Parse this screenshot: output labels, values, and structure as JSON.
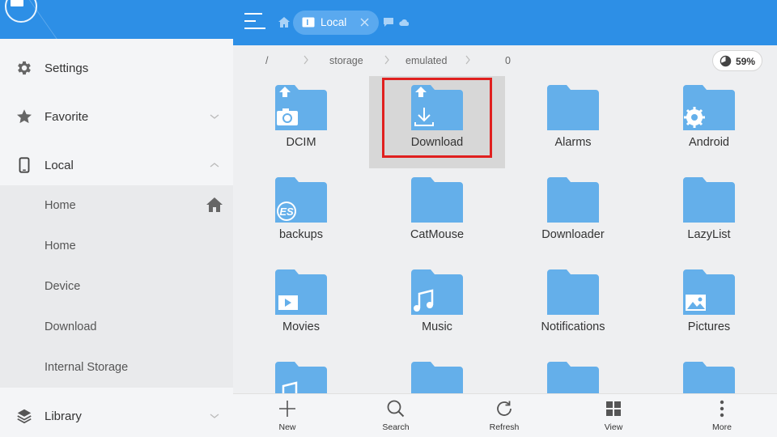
{
  "colors": {
    "accent": "#2d8fe6",
    "folder": "#64afea",
    "highlight": "#e0201f"
  },
  "sidebar": {
    "items": [
      {
        "label": "Settings",
        "icon": "gear-icon"
      },
      {
        "label": "Favorite",
        "icon": "star-icon"
      },
      {
        "label": "Local",
        "icon": "phone-icon"
      },
      {
        "label": "Library",
        "icon": "layers-icon"
      }
    ],
    "local_sub": [
      {
        "label": "Home"
      },
      {
        "label": "Home"
      },
      {
        "label": "Device"
      },
      {
        "label": "Download"
      },
      {
        "label": "Internal Storage"
      }
    ]
  },
  "header": {
    "tab_label": "Local"
  },
  "path": {
    "crumbs": [
      "/",
      "storage",
      "emulated",
      "0"
    ],
    "storage_usage": "59%"
  },
  "folders": [
    {
      "name": "DCIM",
      "badge": "camera-icon",
      "pinned": true
    },
    {
      "name": "Download",
      "badge": "download-arrow-icon",
      "pinned": true,
      "selected": true
    },
    {
      "name": "Alarms",
      "badge": ""
    },
    {
      "name": "Android",
      "badge": "gear-icon"
    },
    {
      "name": "backups",
      "badge": "es-logo-icon"
    },
    {
      "name": "CatMouse",
      "badge": ""
    },
    {
      "name": "Downloader",
      "badge": ""
    },
    {
      "name": "LazyList",
      "badge": ""
    },
    {
      "name": "Movies",
      "badge": "play-icon"
    },
    {
      "name": "Music",
      "badge": "music-note-icon"
    },
    {
      "name": "Notifications",
      "badge": ""
    },
    {
      "name": "Pictures",
      "badge": "image-icon"
    },
    {
      "name": "",
      "badge": "music-note-icon"
    },
    {
      "name": "",
      "badge": ""
    },
    {
      "name": "",
      "badge": ""
    },
    {
      "name": "",
      "badge": ""
    }
  ],
  "toolbar": {
    "new_label": "New",
    "search_label": "Search",
    "refresh_label": "Refresh",
    "view_label": "View",
    "more_label": "More"
  }
}
